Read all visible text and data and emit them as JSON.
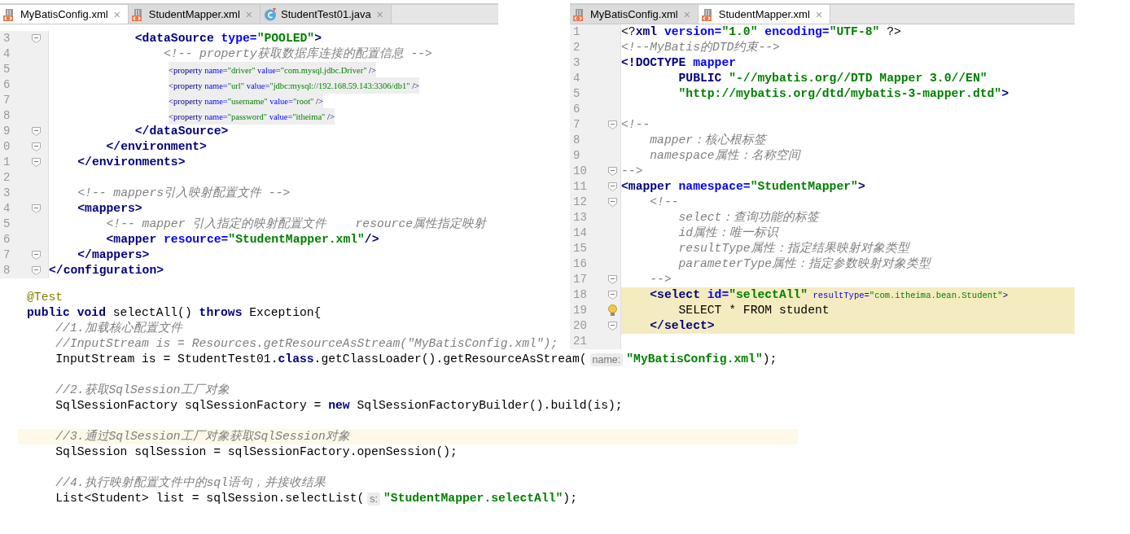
{
  "left_editor": {
    "tabs": [
      {
        "label": "MyBatisConfig.xml",
        "kind": "xml",
        "selected": true,
        "close": "×"
      },
      {
        "label": "StudentMapper.xml",
        "kind": "xml",
        "selected": false,
        "close": "×"
      },
      {
        "label": "StudentTest01.java",
        "kind": "java",
        "selected": false,
        "close": "×"
      }
    ],
    "lines": [
      {
        "number": "3",
        "fold": true,
        "tokens": [
          {
            "kind": "tag",
            "text": "            <dataSource "
          },
          {
            "kind": "attr",
            "text": "type="
          },
          {
            "kind": "str",
            "text": "\"POOLED\""
          },
          {
            "kind": "tag",
            "text": ">"
          }
        ]
      },
      {
        "number": "4",
        "fold": false,
        "tokens": [
          {
            "kind": "comment",
            "text": "                <!-- property获取数据库连接的配置信息 -->"
          }
        ]
      },
      {
        "number": "5",
        "fold": false,
        "kind": "pasted",
        "tokens": [
          {
            "kind": "small_tag",
            "text": "<property "
          },
          {
            "kind": "small_attr",
            "text": "name="
          },
          {
            "kind": "small_str",
            "text": "\"driver\""
          },
          {
            "kind": "small_attr",
            "text": " value="
          },
          {
            "kind": "small_str",
            "text": "\"com.mysql.jdbc.Driver\""
          },
          {
            "kind": "small_tag",
            "text": " />"
          }
        ]
      },
      {
        "number": "6",
        "fold": false,
        "kind": "pasted",
        "tokens": [
          {
            "kind": "small_tag",
            "text": "<property "
          },
          {
            "kind": "small_attr",
            "text": "name="
          },
          {
            "kind": "small_str",
            "text": "\"url\""
          },
          {
            "kind": "small_attr",
            "text": " value="
          },
          {
            "kind": "small_str",
            "text": "\"jdbc:mysql://192.168.59.143:3306/db1\""
          },
          {
            "kind": "small_tag",
            "text": " />"
          }
        ]
      },
      {
        "number": "7",
        "fold": false,
        "kind": "pasted",
        "tokens": [
          {
            "kind": "small_tag",
            "text": "<property "
          },
          {
            "kind": "small_attr",
            "text": "name="
          },
          {
            "kind": "small_str",
            "text": "\"username\""
          },
          {
            "kind": "small_attr",
            "text": " value="
          },
          {
            "kind": "small_str",
            "text": "\"root\""
          },
          {
            "kind": "small_tag",
            "text": " />"
          }
        ]
      },
      {
        "number": "8",
        "fold": false,
        "kind": "pasted",
        "tokens": [
          {
            "kind": "small_tag",
            "text": "<property "
          },
          {
            "kind": "small_attr",
            "text": "name="
          },
          {
            "kind": "small_str",
            "text": "\"password\""
          },
          {
            "kind": "small_attr",
            "text": " value="
          },
          {
            "kind": "small_str",
            "text": "\"itheima\""
          },
          {
            "kind": "small_tag",
            "text": " />"
          }
        ]
      },
      {
        "number": "9",
        "fold": true,
        "tokens": [
          {
            "kind": "tag",
            "text": "            </dataSource>"
          }
        ]
      },
      {
        "number": "0",
        "fold": true,
        "tokens": [
          {
            "kind": "tag",
            "text": "        </environment>"
          }
        ]
      },
      {
        "number": "1",
        "fold": true,
        "tokens": [
          {
            "kind": "tag",
            "text": "    </environments>"
          }
        ]
      },
      {
        "number": "2",
        "fold": false
      },
      {
        "number": "3",
        "fold": false,
        "tokens": [
          {
            "kind": "comment",
            "text": "    <!-- mappers引入映射配置文件 -->"
          }
        ]
      },
      {
        "number": "4",
        "fold": true,
        "tokens": [
          {
            "kind": "tag",
            "text": "    <mappers>"
          }
        ]
      },
      {
        "number": "5",
        "fold": false,
        "tokens": [
          {
            "kind": "comment",
            "text": "        <!-- mapper 引入指定的映射配置文件    resource属性指定映射"
          }
        ]
      },
      {
        "number": "6",
        "fold": false,
        "tokens": [
          {
            "kind": "tag",
            "text": "        <mapper "
          },
          {
            "kind": "attr",
            "text": "resource="
          },
          {
            "kind": "str",
            "text": "\"StudentMapper.xml\""
          },
          {
            "kind": "tag",
            "text": "/>"
          }
        ]
      },
      {
        "number": "7",
        "fold": true,
        "tokens": [
          {
            "kind": "tag",
            "text": "    </mappers>"
          }
        ]
      },
      {
        "number": "8",
        "fold": true,
        "tokens": [
          {
            "kind": "tag",
            "text": "</configuration>"
          }
        ]
      }
    ]
  },
  "right_editor": {
    "tabs": [
      {
        "label": "MyBatisConfig.xml",
        "kind": "xml",
        "selected": false,
        "close": "×"
      },
      {
        "label": "StudentMapper.xml",
        "kind": "xml",
        "selected": true,
        "close": "×"
      }
    ],
    "lines": [
      {
        "number": "1",
        "fold": false,
        "bulb": false,
        "highlighted": false,
        "tokens": [
          {
            "kind": "plain",
            "text": "<?"
          },
          {
            "kind": "tag",
            "text": "xml "
          },
          {
            "kind": "attr",
            "text": "version="
          },
          {
            "kind": "str",
            "text": "\"1.0\""
          },
          {
            "kind": "attr",
            "text": " encoding="
          },
          {
            "kind": "str",
            "text": "\"UTF-8\""
          },
          {
            "kind": "plain",
            "text": " ?>"
          }
        ]
      },
      {
        "number": "2",
        "fold": false,
        "bulb": false,
        "highlighted": false,
        "tokens": [
          {
            "kind": "comment",
            "text": "<!--MyBatis的DTD约束-->"
          }
        ]
      },
      {
        "number": "3",
        "fold": false,
        "bulb": false,
        "highlighted": false,
        "tokens": [
          {
            "kind": "tag",
            "text": "<!DOCTYPE "
          },
          {
            "kind": "attr",
            "text": "mapper"
          }
        ]
      },
      {
        "number": "4",
        "fold": false,
        "bulb": false,
        "highlighted": false,
        "tokens": [
          {
            "kind": "tag",
            "text": "        PUBLIC "
          },
          {
            "kind": "str",
            "text": "\"-//mybatis.org//DTD Mapper 3.0//EN\""
          }
        ]
      },
      {
        "number": "5",
        "fold": false,
        "bulb": false,
        "highlighted": false,
        "tokens": [
          {
            "kind": "str",
            "text": "        \"http://mybatis.org/dtd/mybatis-3-mapper.dtd\""
          },
          {
            "kind": "tag",
            "text": ">"
          }
        ]
      },
      {
        "number": "6",
        "fold": false,
        "bulb": false,
        "highlighted": false
      },
      {
        "number": "7",
        "fold": true,
        "bulb": false,
        "highlighted": false,
        "tokens": [
          {
            "kind": "comment",
            "text": "<!--"
          }
        ]
      },
      {
        "number": "8",
        "fold": false,
        "bulb": false,
        "highlighted": false,
        "tokens": [
          {
            "kind": "comment",
            "text": "    mapper：核心根标签"
          }
        ]
      },
      {
        "number": "9",
        "fold": false,
        "bulb": false,
        "highlighted": false,
        "tokens": [
          {
            "kind": "comment",
            "text": "    namespace属性：名称空间"
          }
        ]
      },
      {
        "number": "10",
        "fold": true,
        "bulb": false,
        "highlighted": false,
        "tokens": [
          {
            "kind": "comment",
            "text": "-->"
          }
        ]
      },
      {
        "number": "11",
        "fold": true,
        "bulb": false,
        "highlighted": false,
        "tokens": [
          {
            "kind": "tag",
            "text": "<mapper "
          },
          {
            "kind": "attr",
            "text": "namespace="
          },
          {
            "kind": "str",
            "text": "\"StudentMapper\""
          },
          {
            "kind": "tag",
            "text": ">"
          }
        ]
      },
      {
        "number": "12",
        "fold": true,
        "bulb": false,
        "highlighted": false,
        "tokens": [
          {
            "kind": "comment",
            "text": "    <!--"
          }
        ]
      },
      {
        "number": "13",
        "fold": false,
        "bulb": false,
        "highlighted": false,
        "tokens": [
          {
            "kind": "comment",
            "text": "        select：查询功能的标签"
          }
        ]
      },
      {
        "number": "14",
        "fold": false,
        "bulb": false,
        "highlighted": false,
        "tokens": [
          {
            "kind": "comment",
            "text": "        id属性：唯一标识"
          }
        ]
      },
      {
        "number": "15",
        "fold": false,
        "bulb": false,
        "highlighted": false,
        "tokens": [
          {
            "kind": "comment",
            "text": "        resultType属性：指定结果映射对象类型"
          }
        ]
      },
      {
        "number": "16",
        "fold": false,
        "bulb": false,
        "highlighted": false,
        "tokens": [
          {
            "kind": "comment",
            "text": "        parameterType属性：指定参数映射对象类型"
          }
        ]
      },
      {
        "number": "17",
        "fold": true,
        "bulb": false,
        "highlighted": false,
        "tokens": [
          {
            "kind": "comment",
            "text": "    -->"
          }
        ]
      },
      {
        "number": "18",
        "fold": true,
        "bulb": false,
        "highlighted": true,
        "tokens": [
          {
            "kind": "tag",
            "text": "    <select "
          },
          {
            "kind": "attr",
            "text": "id="
          },
          {
            "kind": "str",
            "text": "\"selectAll\""
          },
          {
            "kind": "small_attr",
            "text": " resultType="
          },
          {
            "kind": "small_str",
            "text": "\"com.itheima.bean.Student\""
          },
          {
            "kind": "small_tag",
            "text": ">"
          }
        ]
      },
      {
        "number": "19",
        "fold": false,
        "bulb": true,
        "highlighted": true,
        "tokens": [
          {
            "kind": "plain",
            "text": "        SELECT * FROM student"
          }
        ]
      },
      {
        "number": "20",
        "fold": true,
        "bulb": false,
        "highlighted": true,
        "tokens": [
          {
            "kind": "tag",
            "text": "    </select>"
          }
        ]
      },
      {
        "number": "21",
        "fold": false,
        "bulb": false,
        "highlighted": false
      }
    ]
  },
  "test_code": {
    "blocks": [
      {
        "lines": [
          {
            "current_line": false,
            "tokens": [
              {
                "kind": "annotation",
                "text": "@Test"
              }
            ]
          },
          {
            "current_line": false,
            "tokens": [
              {
                "kind": "kw",
                "text": "public void "
              },
              {
                "kind": "plain",
                "text": "selectAll() "
              },
              {
                "kind": "kw",
                "text": "throws "
              },
              {
                "kind": "plain",
                "text": "Exception{"
              }
            ]
          },
          {
            "current_line": false,
            "tokens": [
              {
                "kind": "comment",
                "text": "    //1.加载核心配置文件"
              }
            ]
          },
          {
            "current_line": false,
            "tokens": [
              {
                "kind": "comment",
                "text": "    //InputStream is = Resources.getResourceAsStream(\"MyBatisConfig.xml\");"
              }
            ]
          },
          {
            "current_line": false,
            "tokens": [
              {
                "kind": "plain",
                "text": "    InputStream is = StudentTest01."
              },
              {
                "kind": "kw",
                "text": "class"
              },
              {
                "kind": "plain",
                "text": ".getClassLoader().getResourceAsStream("
              },
              {
                "kind": "hint",
                "text": "name:"
              },
              {
                "kind": "str",
                "text": "\"MyBatisConfig.xml\""
              },
              {
                "kind": "plain",
                "text": ");"
              }
            ]
          }
        ]
      },
      {
        "lines": [
          {
            "current_line": false,
            "tokens": [
              {
                "kind": "comment",
                "text": "    //2.获取SqlSession工厂对象"
              }
            ]
          },
          {
            "current_line": false,
            "tokens": [
              {
                "kind": "plain",
                "text": "    SqlSessionFactory sqlSessionFactory = "
              },
              {
                "kind": "kw",
                "text": "new "
              },
              {
                "kind": "plain",
                "text": "SqlSessionFactoryBuilder().build(is);"
              }
            ]
          }
        ]
      },
      {
        "lines": [
          {
            "current_line": true,
            "tokens": [
              {
                "kind": "comment",
                "text": "    //3.通过SqlSession工厂对象获取SqlSession对象"
              }
            ]
          },
          {
            "current_line": false,
            "tokens": [
              {
                "kind": "plain",
                "text": "    SqlSession sqlSession = sqlSessionFactory.openSession();"
              }
            ]
          }
        ]
      },
      {
        "lines": [
          {
            "current_line": false,
            "tokens": [
              {
                "kind": "comment",
                "text": "    //4.执行映射配置文件中的sql语句，并接收结果"
              }
            ]
          },
          {
            "current_line": false,
            "tokens": [
              {
                "kind": "plain",
                "text": "    List<Student> list = sqlSession.selectList("
              },
              {
                "kind": "hint",
                "text": "s:"
              },
              {
                "kind": "str",
                "text": "\"StudentMapper.selectAll\""
              },
              {
                "kind": "plain",
                "text": ");"
              }
            ]
          }
        ]
      }
    ]
  }
}
